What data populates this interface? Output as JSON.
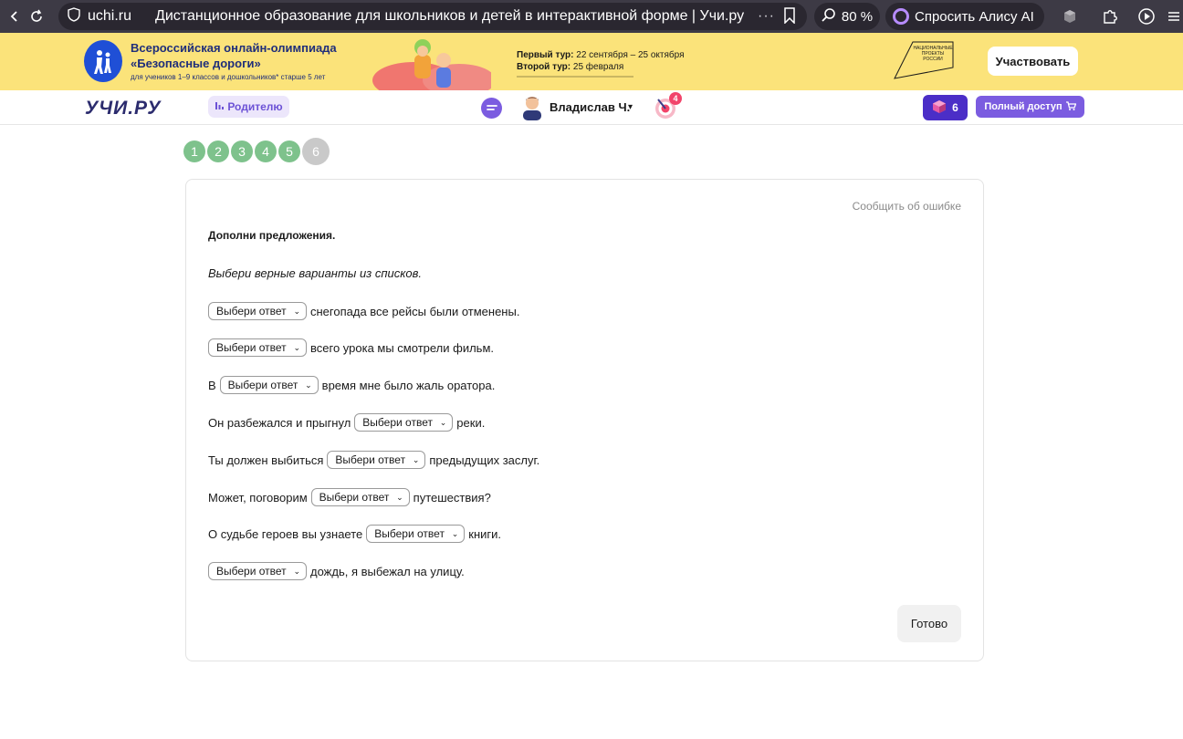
{
  "browser": {
    "domain": "uchi.ru",
    "tab_title": "Дистанционное образование для школьников и детей в интерактивной форме | Учи.ру",
    "more": "···",
    "zoom": "80 %",
    "alice": "Спросить Алису AI"
  },
  "promo": {
    "title_line1": "Всероссийская онлайн-олимпиада",
    "title_line2": "«Безопасные дороги»",
    "subtitle": "для учеников 1–9 классов и дошкольников* старше 5 лет",
    "round1_label": "Первый тур:",
    "round1_dates": "22 сентября – 25 октября",
    "round2_label": "Второй тур:",
    "round2_dates": "25 февраля",
    "np_logo_text": "НАЦИОНАЛЬНЫЕ ПРОЕКТЫ РОССИИ",
    "participate": "Участвовать"
  },
  "header": {
    "logo": "УЧИ.РУ",
    "role": "Родителю",
    "user_name": "Владислав Ч.",
    "target_badge": "4",
    "cubes": "6",
    "full_access": "Полный доступ"
  },
  "steps": [
    "1",
    "2",
    "3",
    "4",
    "5",
    "6"
  ],
  "task": {
    "report": "Сообщить об ошибке",
    "title": "Дополни предложения.",
    "hint": "Выбери верные варианты из списков.",
    "placeholder": "Выбери ответ",
    "sentences": [
      {
        "before": "",
        "after": "снегопада все рейсы были отменены."
      },
      {
        "before": "",
        "after": "всего урока мы смотрели фильм."
      },
      {
        "before": "В",
        "after": "время мне было жаль оратора."
      },
      {
        "before": "Он разбежался и прыгнул",
        "after": "реки."
      },
      {
        "before": "Ты должен выбиться",
        "after": "предыдущих заслуг."
      },
      {
        "before": "Может, поговорим",
        "after": "путешествия?"
      },
      {
        "before": "О судьбе героев вы узнаете",
        "after": "книги."
      },
      {
        "before": "",
        "after": "дождь, я выбежал на улицу."
      }
    ],
    "done": "Готово"
  },
  "colors": {
    "browser_bg": "#3d3a45",
    "promo_bg": "#fbe37a",
    "accent_purple": "#7b5ce0",
    "step_done": "#7ec28c",
    "step_current": "#c9c9c9"
  }
}
